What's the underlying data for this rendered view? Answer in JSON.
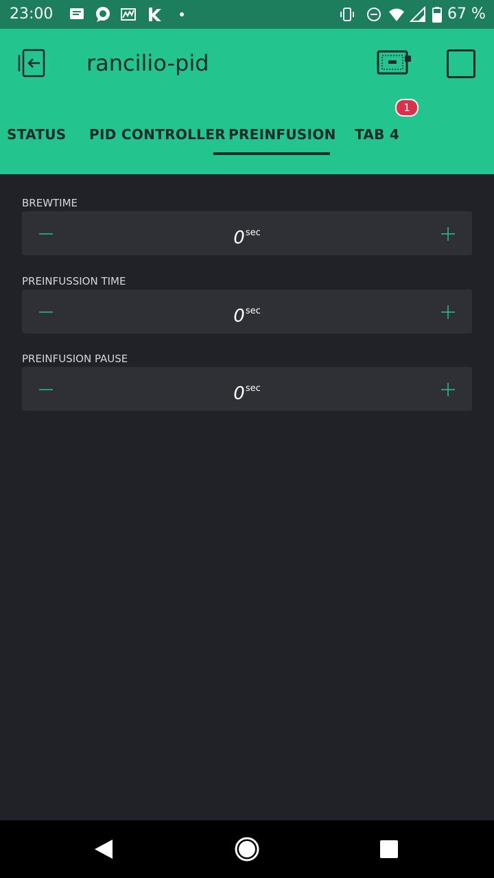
{
  "status_bar": {
    "time": "23:00",
    "battery_text": "67 %",
    "left_icons": [
      "message-icon",
      "chat-bubble-icon",
      "photo-gallery-icon",
      "k-app-icon",
      "dot-icon"
    ],
    "right_icons": [
      "vibrate-icon",
      "dnd-icon",
      "wifi-icon",
      "cell-signal-icon",
      "battery-icon"
    ]
  },
  "header": {
    "title": "rancilio-pid",
    "badge_count": "1",
    "bg_color": "#23c48e"
  },
  "tabs": [
    {
      "label": "STATUS",
      "active": false
    },
    {
      "label": "PID CONTROLLER",
      "active": false
    },
    {
      "label": "PREINFUSION",
      "active": true
    },
    {
      "label": "TAB 4",
      "active": false
    }
  ],
  "fields": [
    {
      "label": "BREWTIME",
      "value": "0",
      "unit": "sec"
    },
    {
      "label": "PREINFUSSION TIME",
      "value": "0",
      "unit": "sec"
    },
    {
      "label": "PREINFUSION PAUSE",
      "value": "0",
      "unit": "sec"
    }
  ],
  "colors": {
    "accent": "#23c48e",
    "background": "#212227",
    "stepper_bg": "#2e3035",
    "badge": "#d8334a"
  }
}
